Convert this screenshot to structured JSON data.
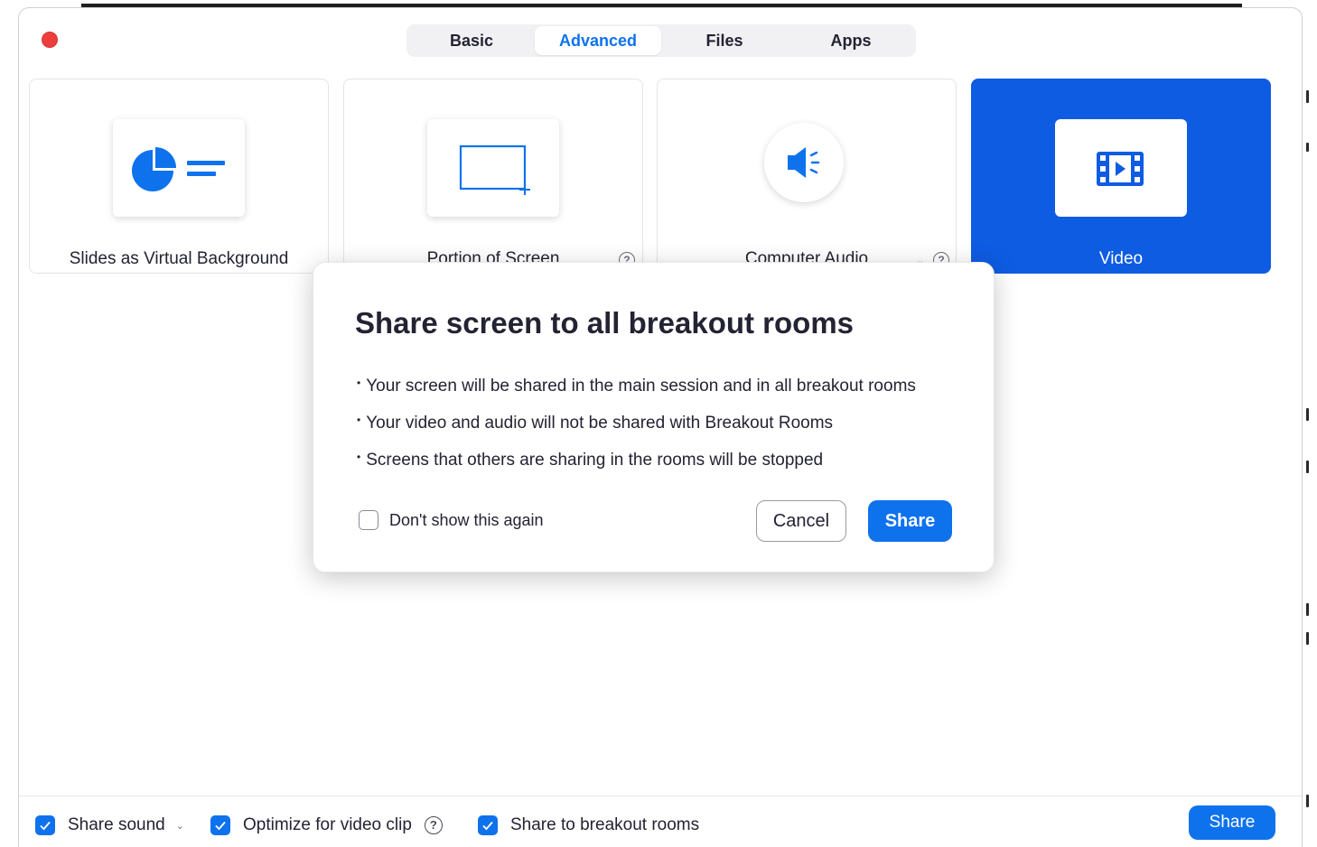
{
  "tabs": [
    {
      "label": "Basic"
    },
    {
      "label": "Advanced"
    },
    {
      "label": "Files"
    },
    {
      "label": "Apps"
    }
  ],
  "active_tab": "Advanced",
  "cards": [
    {
      "label": "Slides as Virtual Background",
      "icon": "pie-chart-slides-icon"
    },
    {
      "label": "Portion of Screen",
      "icon": "screen-portion-icon"
    },
    {
      "label": "Computer Audio",
      "icon": "speaker-icon"
    },
    {
      "label": "Video",
      "icon": "film-icon"
    }
  ],
  "selected_card": "Video",
  "dialog": {
    "title": "Share screen to all breakout rooms",
    "bullets": [
      "Your screen will be shared in the main session and in all breakout rooms",
      "Your video and audio will not be shared with Breakout Rooms",
      "Screens that others are sharing in the rooms will be stopped"
    ],
    "checkbox_label": "Don't show this again",
    "checkbox_checked": false,
    "cancel_label": "Cancel",
    "share_label": "Share"
  },
  "bottom": {
    "share_sound": {
      "label": "Share sound",
      "checked": true
    },
    "optimize": {
      "label": "Optimize for video clip",
      "checked": true
    },
    "breakout": {
      "label": "Share to breakout rooms",
      "checked": true
    },
    "share_label": "Share"
  },
  "colors": {
    "accent": "#0e72ed",
    "selected_card": "#0e5ce2",
    "close_dot": "#ee3d3d"
  }
}
